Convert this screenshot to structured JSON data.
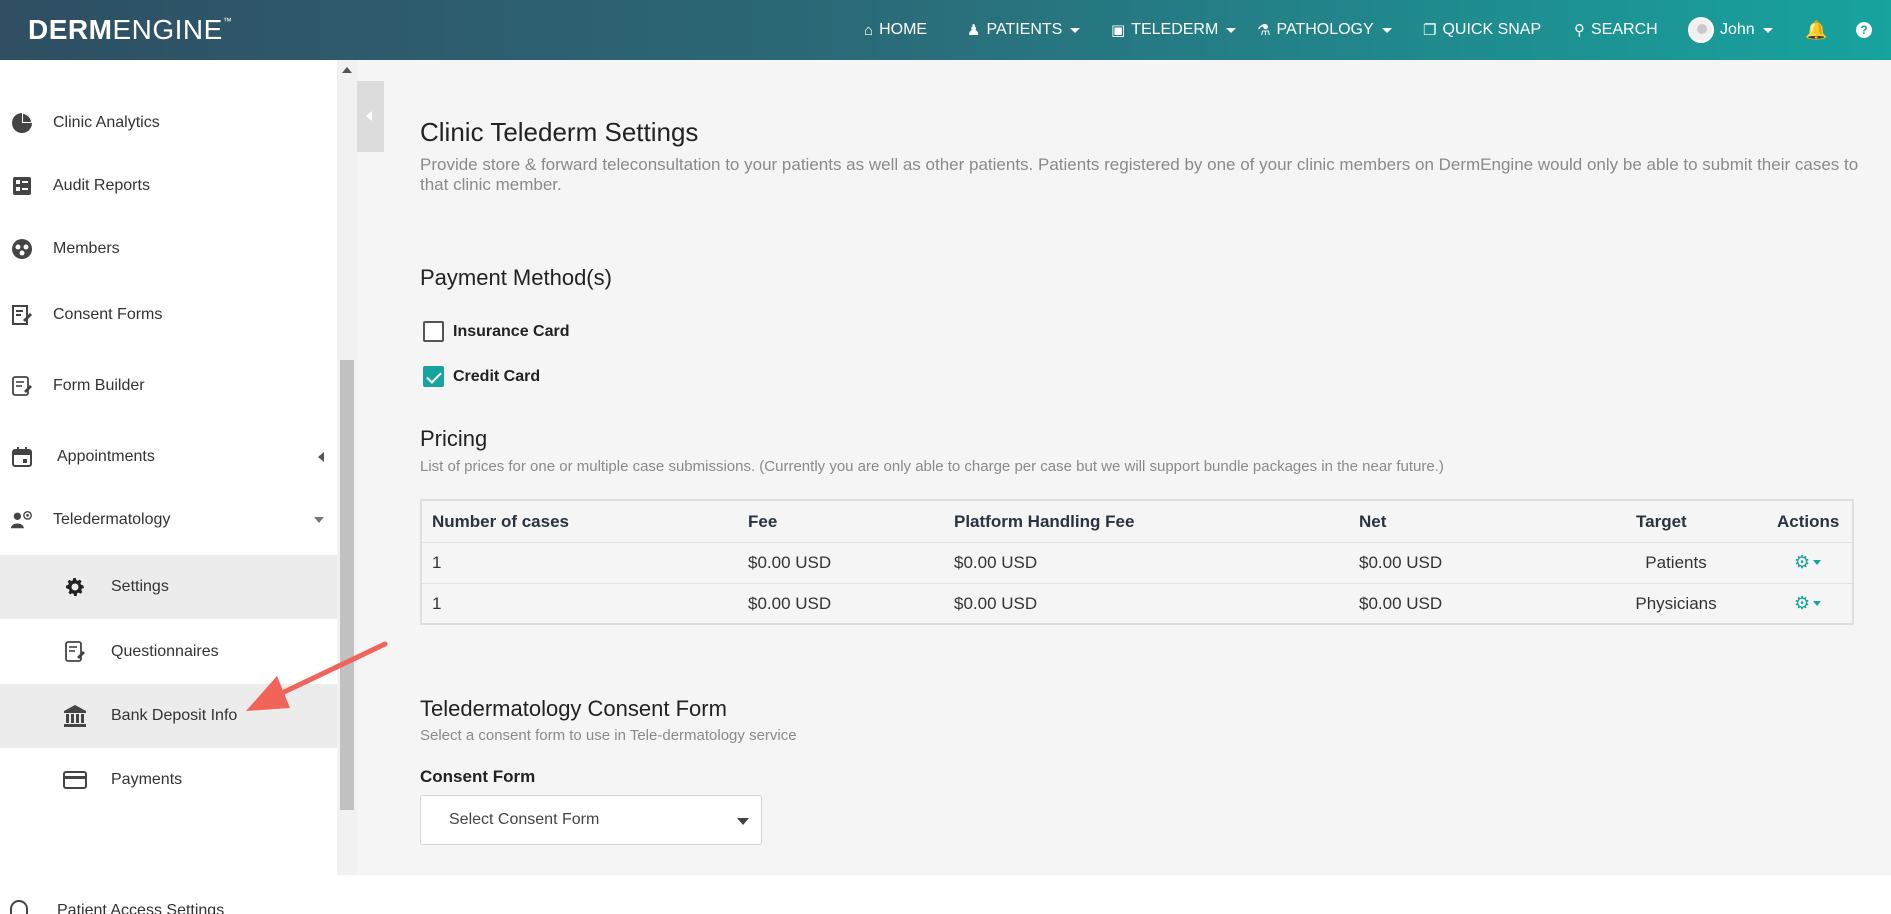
{
  "brand": {
    "logo_bold": "DERM",
    "logo_light": "ENGINE",
    "logo_tm": "™"
  },
  "topnav": {
    "home": "HOME",
    "patients": "PATIENTS",
    "telederm": "TELEDERM",
    "pathology": "PATHOLOGY",
    "quick_snap": "QUICK SNAP",
    "search": "SEARCH",
    "user": "John"
  },
  "sidebar": {
    "items": [
      {
        "label": "Clinic Analytics",
        "icon": "pie-chart-icon"
      },
      {
        "label": "Audit Reports",
        "icon": "report-icon"
      },
      {
        "label": "Members",
        "icon": "members-icon"
      },
      {
        "label": "Consent Forms",
        "icon": "edit-doc-icon"
      },
      {
        "label": "Form Builder",
        "icon": "form-builder-icon"
      },
      {
        "label": "Appointments",
        "icon": "calendar-icon"
      },
      {
        "label": "Teledermatology",
        "icon": "telederm-icon"
      }
    ],
    "sub_items": [
      {
        "label": "Settings",
        "icon": "gear-icon",
        "active": true
      },
      {
        "label": "Questionnaires",
        "icon": "questionnaire-icon",
        "active": false
      },
      {
        "label": "Bank Deposit Info",
        "icon": "bank-icon",
        "active": true
      },
      {
        "label": "Payments",
        "icon": "credit-card-icon",
        "active": false
      }
    ],
    "cutoff_label": "Patient Access Settings"
  },
  "main": {
    "title": "Clinic Telederm Settings",
    "description": "Provide store & forward teleconsultation to your patients as well as other patients. Patients registered by one of your clinic members on DermEngine would only be able to submit their cases to that clinic member.",
    "payment_heading": "Payment Method(s)",
    "payment_options": [
      {
        "label": "Insurance Card",
        "checked": false
      },
      {
        "label": "Credit Card",
        "checked": true
      }
    ],
    "pricing_heading": "Pricing",
    "pricing_sub": "List of prices for one or multiple case submissions. (Currently you are only able to charge per case but we will support bundle packages in the near future.)",
    "pricing_columns": [
      "Number of cases",
      "Fee",
      "Platform Handling Fee",
      "Net",
      "Target",
      "Actions"
    ],
    "pricing_rows": [
      {
        "cases": "1",
        "fee": "$0.00 USD",
        "platform_fee": "$0.00 USD",
        "net": "$0.00 USD",
        "target": "Patients"
      },
      {
        "cases": "1",
        "fee": "$0.00 USD",
        "platform_fee": "$0.00 USD",
        "net": "$0.00 USD",
        "target": "Physicians"
      }
    ],
    "consent_heading": "Teledermatology Consent Form",
    "consent_sub": "Select a consent form to use in Tele-dermatology service",
    "consent_label": "Consent Form",
    "consent_select_placeholder": "Select Consent Form"
  },
  "colors": {
    "accent": "#17a39e",
    "arrow": "#f0645a",
    "header_dark": "#2f4e62"
  }
}
